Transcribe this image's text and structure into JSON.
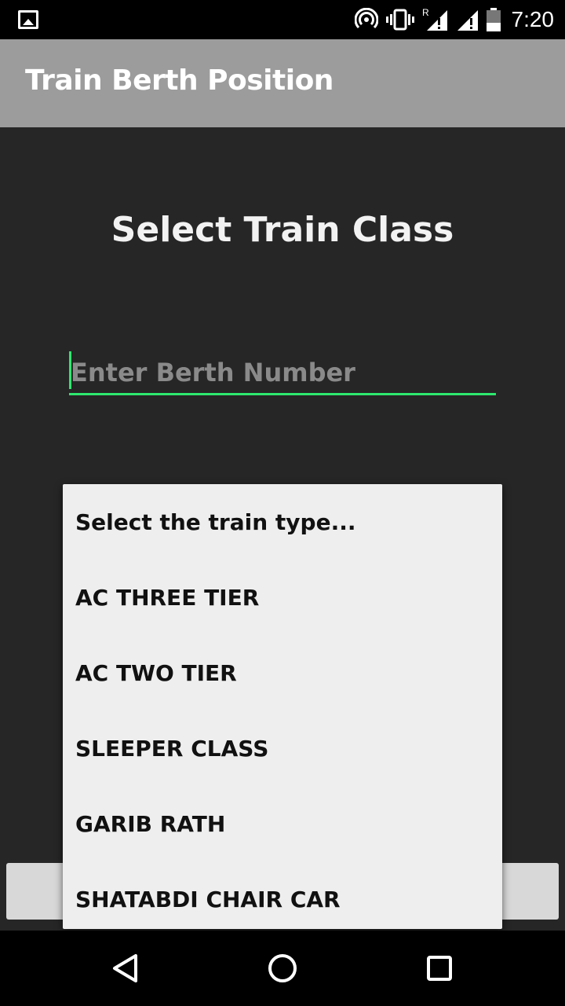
{
  "status_bar": {
    "time": "7:20",
    "icons": [
      "gallery-notification-icon",
      "hotspot-icon",
      "vibrate-icon",
      "signal-roaming-icon",
      "signal-icon",
      "battery-icon"
    ]
  },
  "app_bar": {
    "title": "Train Berth Position",
    "background": "#9c9c9c"
  },
  "main": {
    "heading": "Select Train Class",
    "berth_input": {
      "placeholder": "Enter Berth Number",
      "value": "",
      "accent": "#2ee86e"
    },
    "button_label": ""
  },
  "dropdown": {
    "items": [
      "Select the train type...",
      "AC THREE TIER",
      "AC TWO TIER",
      "SLEEPER CLASS",
      "GARIB RATH",
      "SHATABDI CHAIR CAR"
    ]
  },
  "nav_bar": {
    "icons": [
      "back-icon",
      "home-icon",
      "recents-icon"
    ]
  }
}
